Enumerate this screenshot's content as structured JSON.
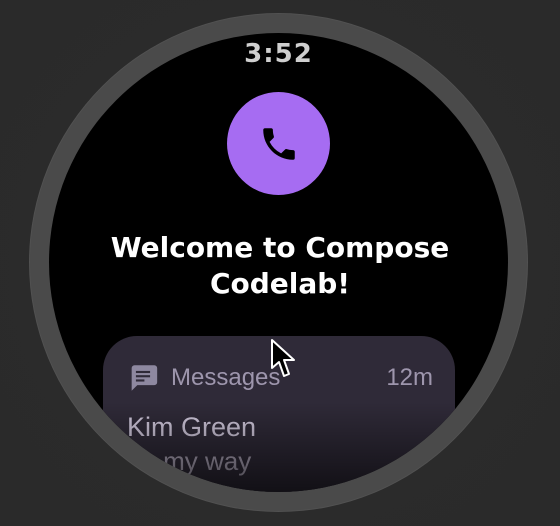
{
  "watch": {
    "time": "3:52",
    "welcome_line_1": "Welcome to Compose",
    "welcome_line_2": "Codelab!"
  },
  "call_button": {
    "icon": "phone-icon",
    "accent_color": "#a66cf2"
  },
  "notification": {
    "app_name": "Messages",
    "age": "12m",
    "sender": "Kim Green",
    "preview": "on my way",
    "icon": "message-icon"
  }
}
